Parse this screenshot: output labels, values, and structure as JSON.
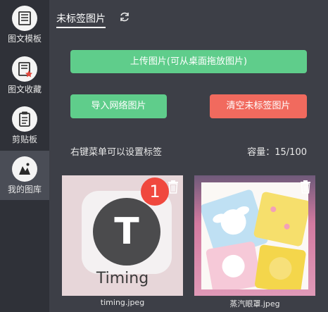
{
  "sidebar": {
    "items": [
      {
        "label": "图文模板",
        "icon": "template-icon"
      },
      {
        "label": "图文收藏",
        "icon": "favorites-icon"
      },
      {
        "label": "剪贴板",
        "icon": "clipboard-icon"
      },
      {
        "label": "我的图库",
        "icon": "gallery-icon"
      }
    ],
    "active_index": 3
  },
  "tabs": {
    "active_label": "未标签图片"
  },
  "buttons": {
    "upload": "上传图片(可从桌面拖放图片)",
    "import": "导入网络图片",
    "clear": "清空未标签图片"
  },
  "hint": "右键菜单可以设置标签",
  "capacity": "容量：15/100",
  "images": [
    {
      "caption": "timing.jpeg",
      "badge": "1",
      "app_letter": "T",
      "app_name": "Timing"
    },
    {
      "caption": "蒸汽眼罩.jpeg"
    }
  ],
  "colors": {
    "green": "#5fcd8b",
    "red": "#f16a5e",
    "sidebar_bg": "#2f3138",
    "main_bg": "#3d3f47"
  }
}
